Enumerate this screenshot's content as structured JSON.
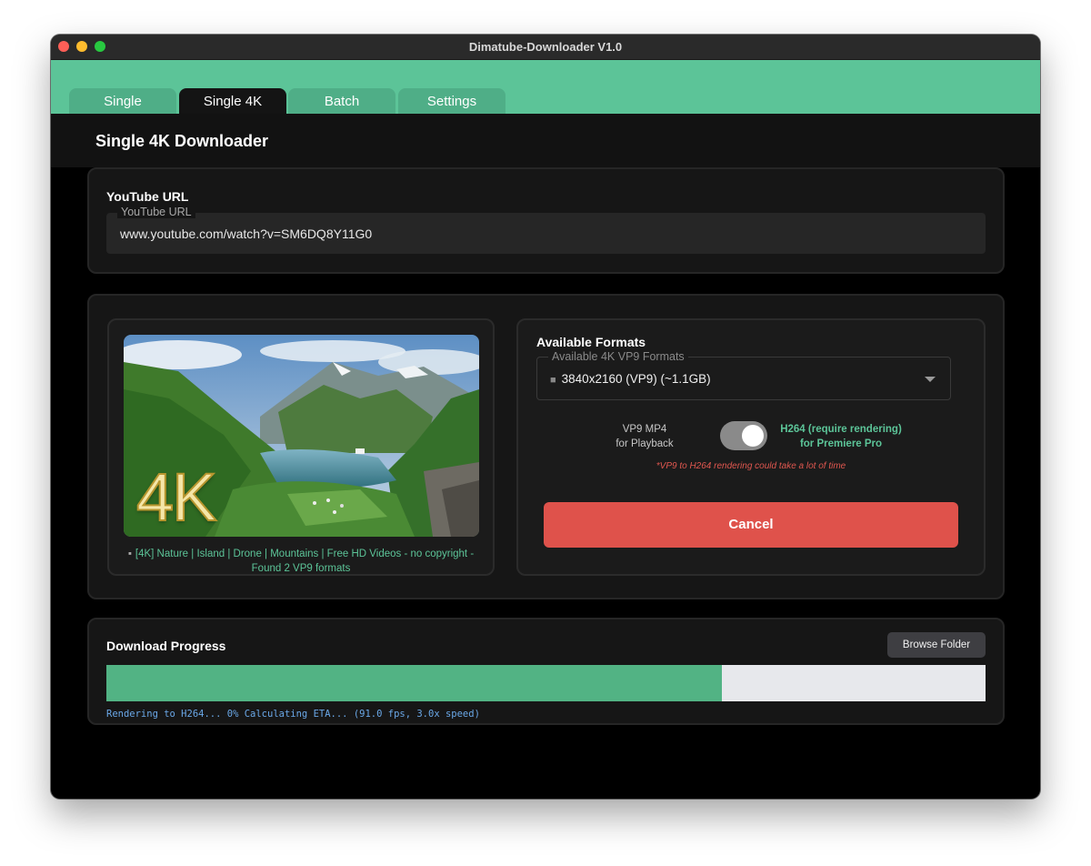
{
  "window": {
    "title": "Dimatube-Downloader V1.0"
  },
  "tabs": [
    {
      "label": "Single",
      "active": false
    },
    {
      "label": "Single 4K",
      "active": true
    },
    {
      "label": "Batch",
      "active": false
    },
    {
      "label": "Settings",
      "active": false
    }
  ],
  "page": {
    "title": "Single 4K Downloader"
  },
  "url_section": {
    "heading": "YouTube URL",
    "field_label": "YouTube URL",
    "value": "www.youtube.com/watch?v=SM6DQ8Y11G0"
  },
  "preview": {
    "overlay_text": "4K",
    "caption_icon": "clapper-icon",
    "video_title": "[4K] Nature | Island | Drone | Mountains | Free HD Videos - no copyright -",
    "status": "Found 2 VP9 formats"
  },
  "formats": {
    "heading": "Available Formats",
    "select_label": "Available 4K VP9 Formats",
    "selected_icon": "film-icon",
    "selected_value": "3840x2160 (VP9) (~1.1GB)",
    "option_left_line1": "VP9 MP4",
    "option_left_line2": "for Playback",
    "option_right_line1": "H264 (require rendering)",
    "option_right_line2": "for Premiere Pro",
    "toggle_on": true,
    "warning": "*VP9 to H264 rendering could take a lot of time",
    "cancel_label": "Cancel"
  },
  "progress": {
    "heading": "Download Progress",
    "browse_label": "Browse Folder",
    "fill_fraction": 0.7,
    "status_text": "Rendering to H264... 0% Calculating ETA... (91.0 fps, 3.0x speed)"
  },
  "colors": {
    "accent_green": "#5cc498",
    "progress_green": "#52b384",
    "cancel_red": "#df524b",
    "status_blue": "#6aa8e8"
  }
}
